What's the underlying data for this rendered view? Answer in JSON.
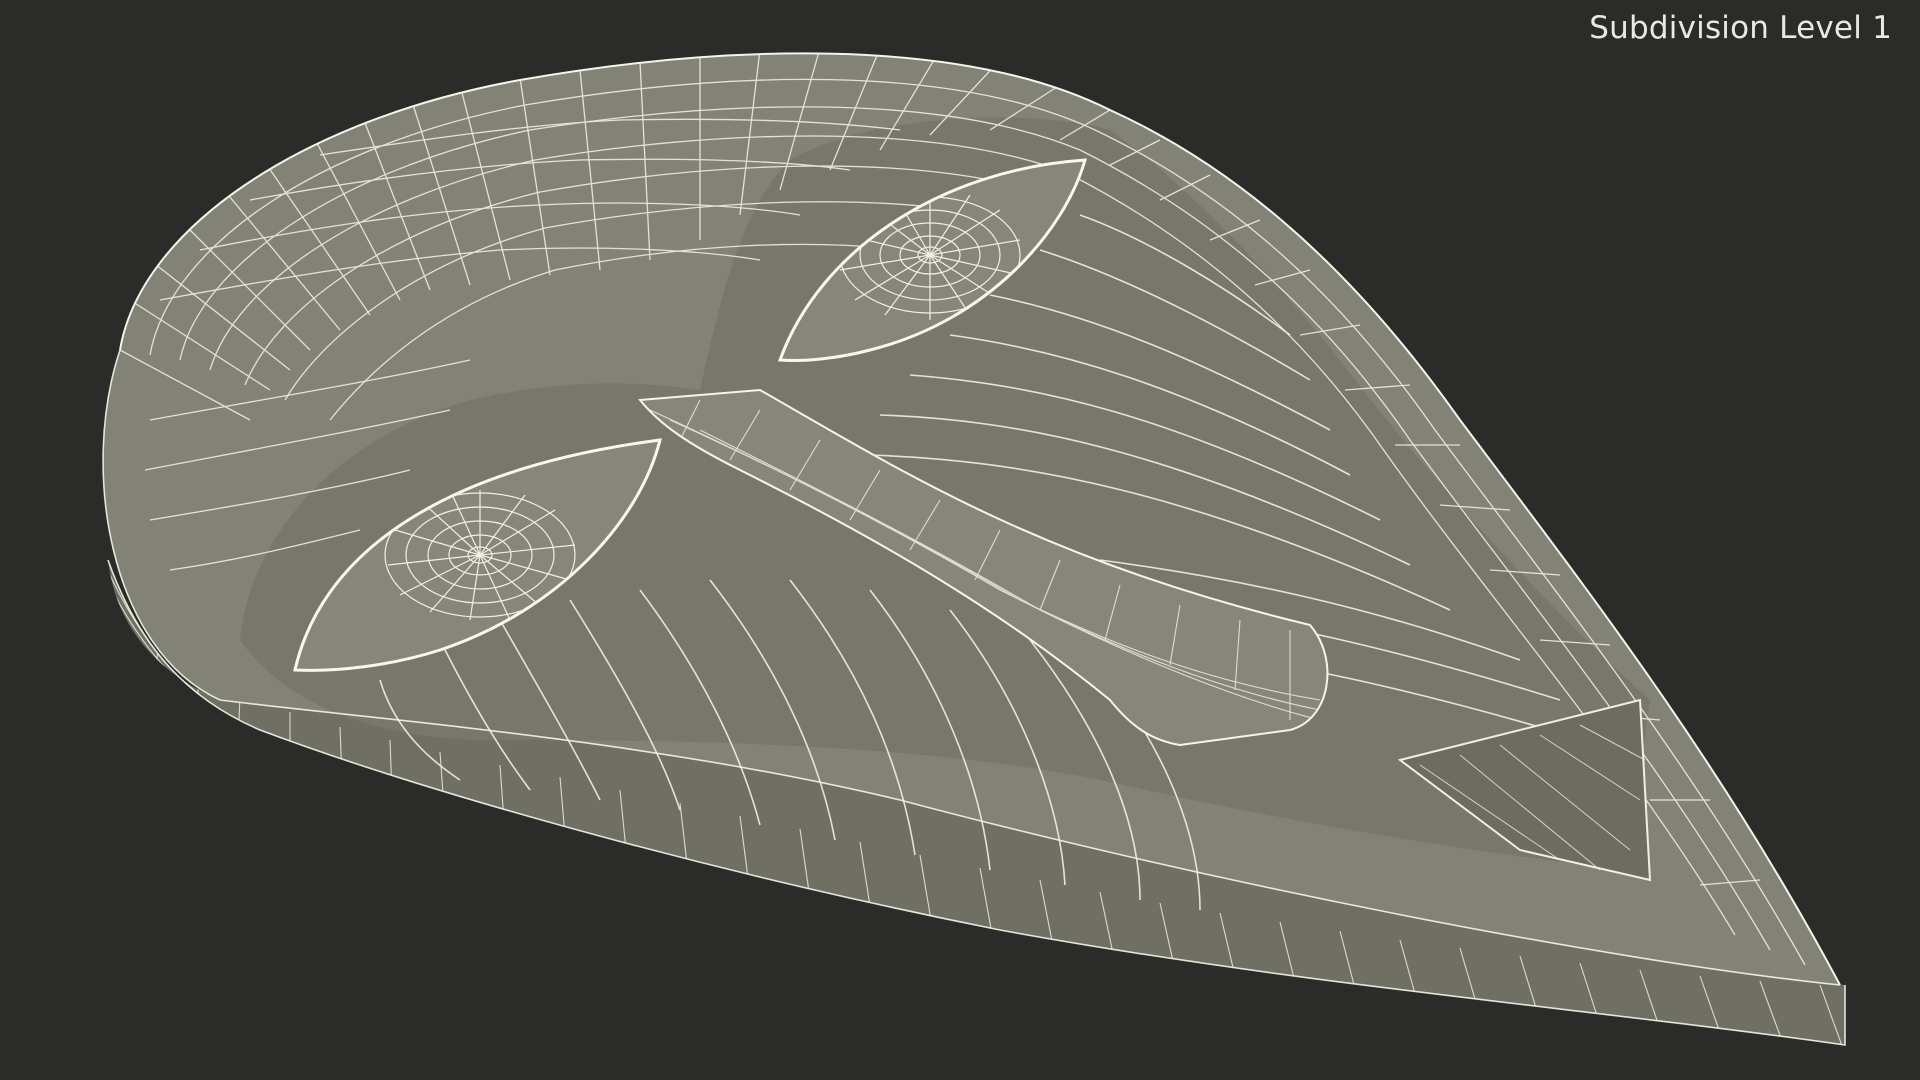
{
  "viewport": {
    "label": "Subdivision Level 1",
    "background_color": "#2b2b29",
    "mesh_fill_color": "#7f7f73",
    "wire_color": "#f2f2e6"
  }
}
